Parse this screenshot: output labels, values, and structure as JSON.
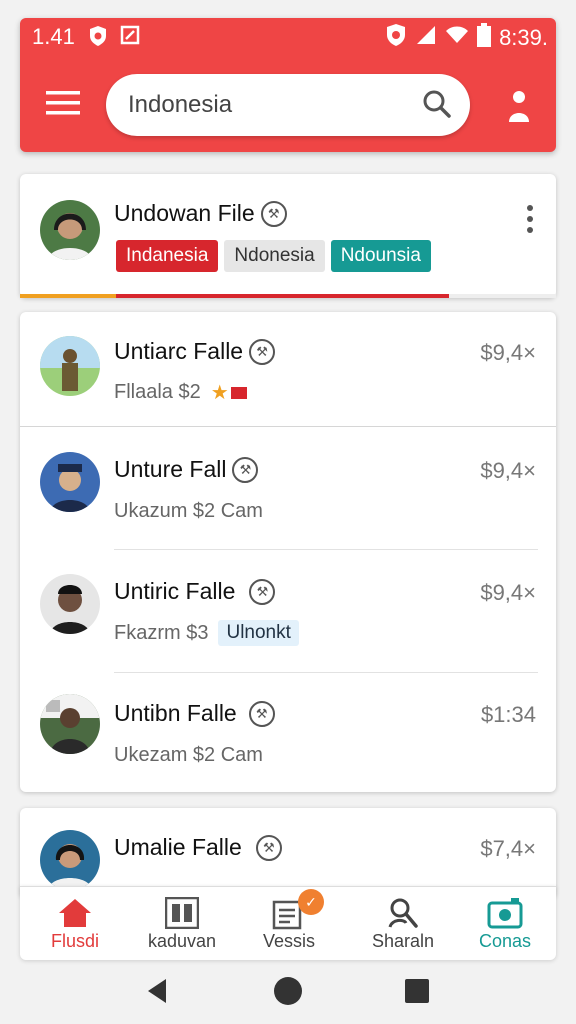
{
  "status_bar": {
    "time": "1.41",
    "battery_text": "8:39."
  },
  "search": {
    "value": "Indonesia"
  },
  "featured": {
    "title": "Undowan File",
    "tags": [
      {
        "label": "Indanesia",
        "bg": "#d7262d",
        "fg": "#ffffff"
      },
      {
        "label": "Ndonesia",
        "bg": "#e6e6e6",
        "fg": "#333333"
      },
      {
        "label": "Ndounsia",
        "bg": "#169a94",
        "fg": "#ffffff"
      }
    ]
  },
  "items": [
    {
      "title": "Untiarc Falle",
      "sub": "Fllaala $2",
      "price": "$9,4×"
    },
    {
      "title": "Unture Fall",
      "sub": "Ukazum $2 Cam",
      "price": "$9,4×"
    },
    {
      "title": "Untiric Falle",
      "sub": "Fkazrm $3",
      "tag": "Ulnonkt",
      "price": "$9,4×"
    },
    {
      "title": "Untibn Falle",
      "sub": "Ukezam $2 Cam",
      "price": "$1:34"
    },
    {
      "title": "Umalie Falle",
      "price": "$7,4×"
    }
  ],
  "bottom_nav": [
    {
      "label": "Flusdi",
      "icon": "home-icon",
      "color": "#e23b3b"
    },
    {
      "label": "kaduvan",
      "icon": "library-icon",
      "color": "#444444"
    },
    {
      "label": "Vessis",
      "icon": "document-icon",
      "color": "#444444",
      "badge": "✓"
    },
    {
      "label": "Sharaln",
      "icon": "person-search-icon",
      "color": "#444444"
    },
    {
      "label": "Conas",
      "icon": "camera-icon",
      "color": "#169a94"
    }
  ],
  "colors": {
    "accent": "#ef4545",
    "teal": "#169a94"
  }
}
